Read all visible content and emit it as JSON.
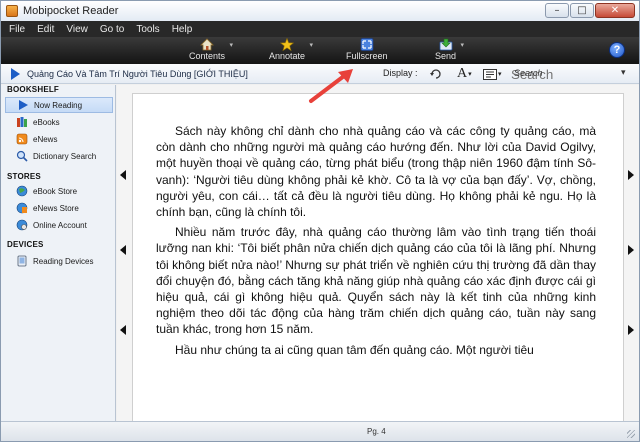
{
  "window": {
    "title": "Mobipocket Reader",
    "controls": [
      "–",
      "□",
      "✕"
    ]
  },
  "menu": [
    "File",
    "Edit",
    "View",
    "Go to",
    "Tools",
    "Help"
  ],
  "toolbar": {
    "contents": "Contents",
    "annotate": "Annotate",
    "fullscreen": "Fullscreen",
    "send": "Send",
    "help": "?"
  },
  "nav": {
    "breadcrumb": "Quảng Cáo Và Tâm Trí Người Tiêu Dùng [GIỚI THIỆU]",
    "display_label": "Display :",
    "font_icon": "A",
    "search_placeholder": "Search"
  },
  "sidebar": {
    "bookshelf_header": "BOOKSHELF",
    "bookshelf_items": [
      "Now Reading",
      "eBooks",
      "eNews",
      "Dictionary Search"
    ],
    "stores_header": "STORES",
    "stores_items": [
      "eBook Store",
      "eNews Store",
      "Online Account"
    ],
    "devices_header": "DEVICES",
    "devices_items": [
      "Reading Devices"
    ]
  },
  "reader": {
    "paragraphs": [
      "Sách này không chỉ dành cho nhà quảng cáo và các công ty quảng cáo, mà còn dành cho những người mà quảng cáo hướng đến. Như lời của David Ogilvy, một huyền thoại về quảng cáo, từng phát biểu (trong thập niên 1960 đậm tính Sô-vanh): ‘Người tiêu dùng không phải kẻ khờ. Cô ta là vợ của bạn đấy’. Vợ, chồng, người yêu, con cái… tất cả đều là người tiêu dùng. Họ không phải kẻ ngu. Họ là chính bạn, cũng là chính tôi.",
      "Nhiều năm trước đây, nhà quảng cáo thường lâm vào tình trạng tiến thoái lưỡng nan khi: ‘Tôi biết phân nửa chiến dịch quảng cáo của tôi là lãng phí. Nhưng tôi không biết nửa nào!’ Nhưng sự phát triển về nghiên cứu thị trường đã dần thay đổi chuyện đó, bằng cách tăng khả năng giúp nhà quảng cáo xác định được cái gì hiệu quả, cái gì không hiệu quả. Quyển sách này là kết tinh của những kinh nghiệm theo dõi tác động của hàng trăm chiến dịch quảng cáo, tuần này sang tuần khác, trong hơn 15 năm.",
      "Hầu như chúng ta ai cũng quan tâm đến quảng cáo. Một người tiêu"
    ]
  },
  "status": {
    "page": "Pg. 4"
  },
  "colors": {
    "toolbar_bg": "#1c1c1c",
    "accent_blue": "#1e5ec6",
    "annotation_arrow": "#e8413a"
  }
}
